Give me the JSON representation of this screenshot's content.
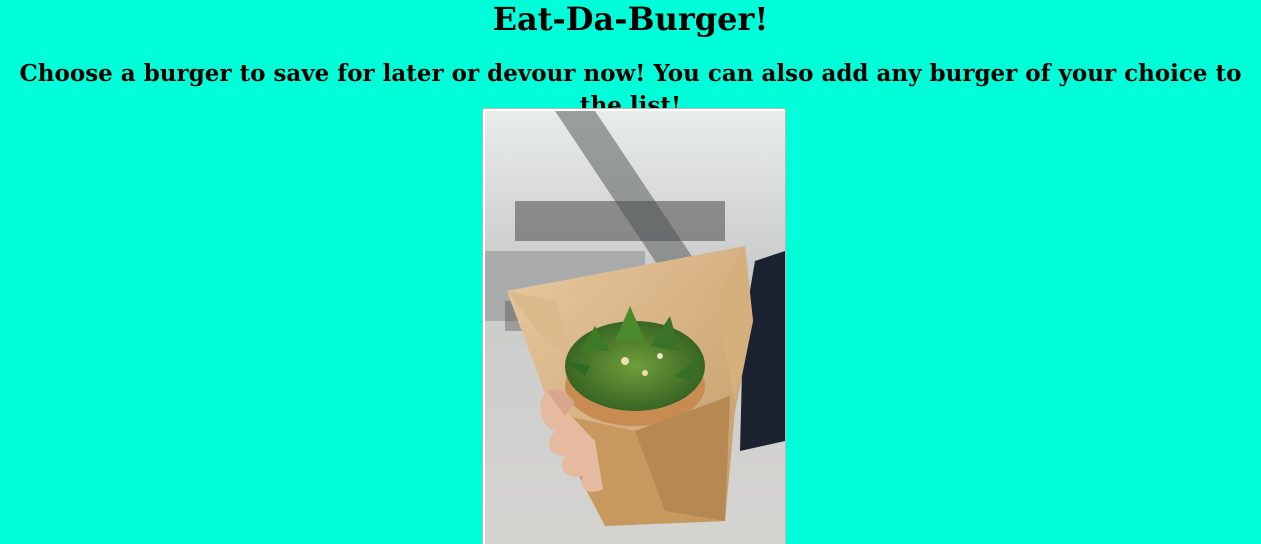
{
  "header": {
    "title": "Eat-Da-Burger!",
    "subtitle": "Choose a burger to save for later or devour now! You can also add any burger of your choice to the list!"
  },
  "card": {
    "image_icon": "burger-in-paper-wrap-photo"
  }
}
